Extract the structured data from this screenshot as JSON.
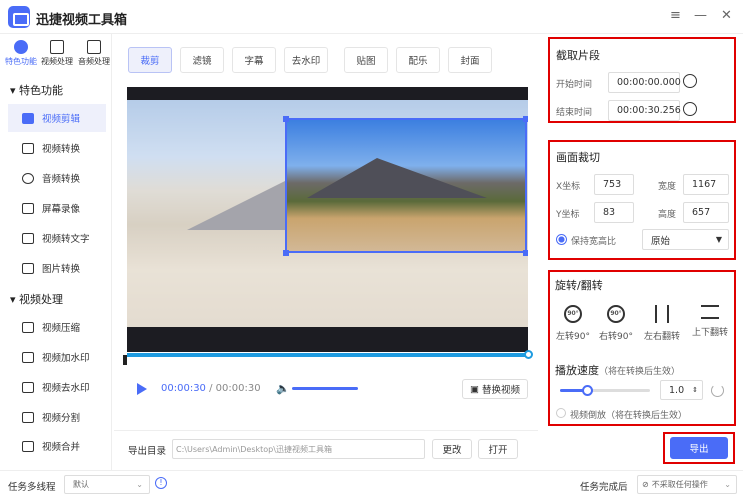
{
  "app": {
    "title": "迅捷视频工具箱"
  },
  "window": {
    "menu_icon": "≡",
    "minimize_icon": "—",
    "close_icon": "✕"
  },
  "sidebar": {
    "top_nav": [
      {
        "label": "特色功能",
        "icon": "star-icon"
      },
      {
        "label": "视频处理",
        "icon": "film-icon"
      },
      {
        "label": "音频处理",
        "icon": "music-icon"
      }
    ],
    "sections": [
      {
        "title": "特色功能",
        "items": [
          "视频剪辑",
          "视频转换",
          "音频转换",
          "屏幕录像",
          "视频转文字",
          "图片转换"
        ]
      },
      {
        "title": "视频处理",
        "items": [
          "视频压缩",
          "视频加水印",
          "视频去水印",
          "视频分割",
          "视频合并"
        ]
      }
    ],
    "active_item": "视频剪辑"
  },
  "tabs": [
    "裁剪",
    "滤镜",
    "字幕",
    "去水印",
    "贴图",
    "配乐",
    "封面"
  ],
  "player": {
    "current_time": "00:00:30",
    "separator": "/",
    "total_time": "00:00:30",
    "progress": 1.0,
    "volume": 1.0,
    "replace_label": "替换视频"
  },
  "export_dir": {
    "label": "导出目录",
    "path": "C:\\Users\\Admin\\Desktop\\迅捷视频工具箱",
    "change_label": "更改",
    "open_label": "打开"
  },
  "clip": {
    "title": "截取片段",
    "start_label": "开始时间",
    "start_value": "00:00:00.000",
    "end_label": "结束时间",
    "end_value": "00:00:30.256"
  },
  "crop": {
    "title": "画面裁切",
    "x_label": "X坐标",
    "x_value": "753",
    "y_label": "Y坐标",
    "y_value": "83",
    "w_label": "宽度",
    "w_value": "1167",
    "h_label": "高度",
    "h_value": "657",
    "keep_ratio_label": "保持宽高比",
    "keep_ratio_checked": true,
    "ratio_value": "原始"
  },
  "rotate": {
    "title": "旋转/翻转",
    "buttons": [
      "左转90°",
      "右转90°",
      "左右翻转",
      "上下翻转"
    ],
    "icon_text": "90°"
  },
  "speed": {
    "title": "播放速度",
    "note": "（将在转换后生效）",
    "value": "1.0",
    "slider_fraction": 0.3,
    "reverse_label": "视频倒放",
    "reverse_note": "（将在转换后生效）",
    "reverse_checked": false
  },
  "export_button": "导出",
  "footer": {
    "thread_label": "任务多线程",
    "thread_value": "默认",
    "after_label": "任务完成后",
    "after_value": "不采取任何操作"
  },
  "colors": {
    "accent": "#4a6cf7",
    "highlight_border": "#e00000",
    "timeline": "#1e9be0"
  }
}
